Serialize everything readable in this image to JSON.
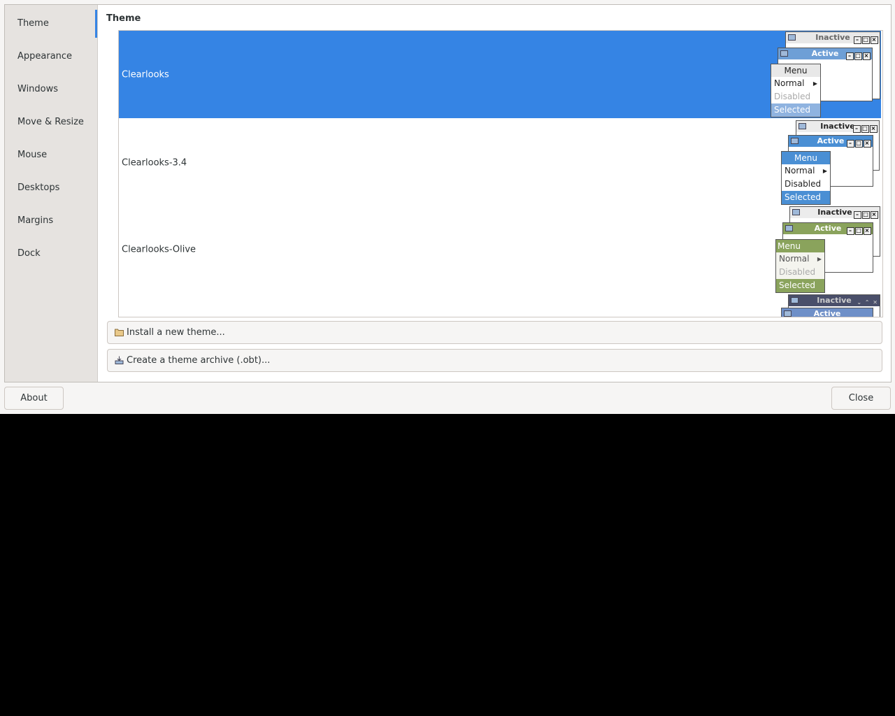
{
  "sidebar": {
    "items": [
      {
        "label": "Theme"
      },
      {
        "label": "Appearance"
      },
      {
        "label": "Windows"
      },
      {
        "label": "Move & Resize"
      },
      {
        "label": "Mouse"
      },
      {
        "label": "Desktops"
      },
      {
        "label": "Margins"
      },
      {
        "label": "Dock"
      }
    ]
  },
  "main": {
    "title": "Theme",
    "themes": [
      {
        "name": "Clearlooks",
        "selected": true
      },
      {
        "name": "Clearlooks-3.4",
        "selected": false
      },
      {
        "name": "Clearlooks-Olive",
        "selected": false
      }
    ],
    "preview": {
      "inactive": "Inactive",
      "active": "Active",
      "menu": "Menu",
      "normal": "Normal",
      "disabled": "Disabled",
      "selected": "Selected"
    },
    "install_label": "Install a new theme...",
    "archive_label": "Create a theme archive (.obt)..."
  },
  "footer": {
    "about_label": "About",
    "close_label": "Close"
  },
  "colors": {
    "accent": "#3584e4",
    "olive": "#8aa35c",
    "blue": "#4a8fd4"
  }
}
